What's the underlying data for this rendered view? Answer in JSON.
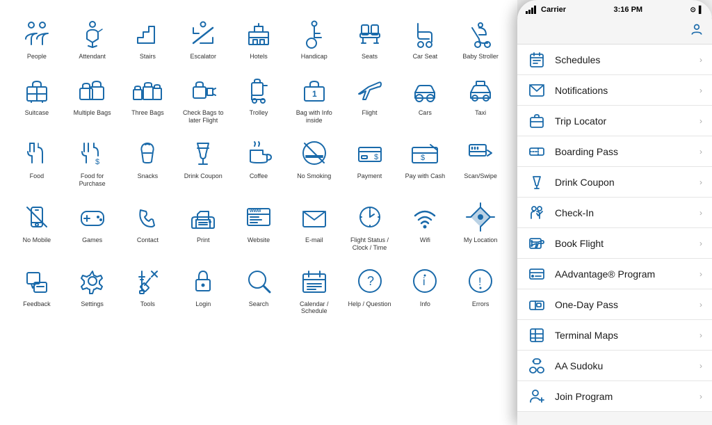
{
  "phone": {
    "carrier": "Carrier",
    "time": "3:16 PM",
    "nav_items": [
      {
        "id": "schedules",
        "label": "Schedules",
        "icon": "calendar"
      },
      {
        "id": "notifications",
        "label": "Notifications",
        "icon": "bell"
      },
      {
        "id": "trip-locator",
        "label": "Trip Locator",
        "icon": "briefcase"
      },
      {
        "id": "boarding-pass",
        "label": "Boarding Pass",
        "icon": "boarding"
      },
      {
        "id": "drink-coupon",
        "label": "Drink Coupon",
        "icon": "cocktail"
      },
      {
        "id": "check-in",
        "label": "Check-In",
        "icon": "checkin"
      },
      {
        "id": "book-flight",
        "label": "Book Flight",
        "icon": "flight"
      },
      {
        "id": "aadvantage",
        "label": "AAdvantage® Program",
        "icon": "aadvantage"
      },
      {
        "id": "one-day-pass",
        "label": "One-Day Pass",
        "icon": "pass"
      },
      {
        "id": "terminal-maps",
        "label": "Terminal Maps",
        "icon": "maps"
      },
      {
        "id": "aa-sudoku",
        "label": "AA Sudoku",
        "icon": "sudoku"
      },
      {
        "id": "join-program",
        "label": "Join Program",
        "icon": "join"
      }
    ]
  },
  "icons": [
    {
      "id": "people",
      "label": "People"
    },
    {
      "id": "attendant",
      "label": "Attendant"
    },
    {
      "id": "stairs",
      "label": "Stairs"
    },
    {
      "id": "escalator",
      "label": "Escalator"
    },
    {
      "id": "hotels",
      "label": "Hotels"
    },
    {
      "id": "handicap",
      "label": "Handicap"
    },
    {
      "id": "seats",
      "label": "Seats"
    },
    {
      "id": "car-seat",
      "label": "Car Seat"
    },
    {
      "id": "baby-stroller",
      "label": "Baby Stroller"
    },
    {
      "id": "suitcase",
      "label": "Suitcase"
    },
    {
      "id": "multiple-bags",
      "label": "Multiple Bags"
    },
    {
      "id": "three-bags",
      "label": "Three Bags"
    },
    {
      "id": "check-bags",
      "label": "Check Bags\nto later Flight"
    },
    {
      "id": "trolley",
      "label": "Trolley"
    },
    {
      "id": "bag-info",
      "label": "Bag with Info inside"
    },
    {
      "id": "flight",
      "label": "Flight"
    },
    {
      "id": "cars",
      "label": "Cars"
    },
    {
      "id": "taxi",
      "label": "Taxi"
    },
    {
      "id": "food",
      "label": "Food"
    },
    {
      "id": "food-purchase",
      "label": "Food for Purchase"
    },
    {
      "id": "snacks",
      "label": "Snacks"
    },
    {
      "id": "drink-coupon",
      "label": "Drink Coupon"
    },
    {
      "id": "coffee",
      "label": "Coffee"
    },
    {
      "id": "no-smoking",
      "label": "No Smoking"
    },
    {
      "id": "payment",
      "label": "Payment"
    },
    {
      "id": "pay-cash",
      "label": "Pay with Cash"
    },
    {
      "id": "scan-swipe",
      "label": "Scan/Swipe"
    },
    {
      "id": "no-mobile",
      "label": "No Mobile"
    },
    {
      "id": "games",
      "label": "Games"
    },
    {
      "id": "contact",
      "label": "Contact"
    },
    {
      "id": "print",
      "label": "Print"
    },
    {
      "id": "website",
      "label": "Website"
    },
    {
      "id": "email",
      "label": "E-mail"
    },
    {
      "id": "flight-status",
      "label": "Flight Status /\nClock / Time"
    },
    {
      "id": "wifi",
      "label": "Wifi"
    },
    {
      "id": "my-location",
      "label": "My Location"
    },
    {
      "id": "feedback",
      "label": "Feedback"
    },
    {
      "id": "settings",
      "label": "Settings"
    },
    {
      "id": "tools",
      "label": "Tools"
    },
    {
      "id": "login",
      "label": "Login"
    },
    {
      "id": "search",
      "label": "Search"
    },
    {
      "id": "calendar",
      "label": "Calendar / Schedule"
    },
    {
      "id": "help",
      "label": "Help / Question"
    },
    {
      "id": "info",
      "label": "Info"
    },
    {
      "id": "errors",
      "label": "Errors"
    }
  ]
}
